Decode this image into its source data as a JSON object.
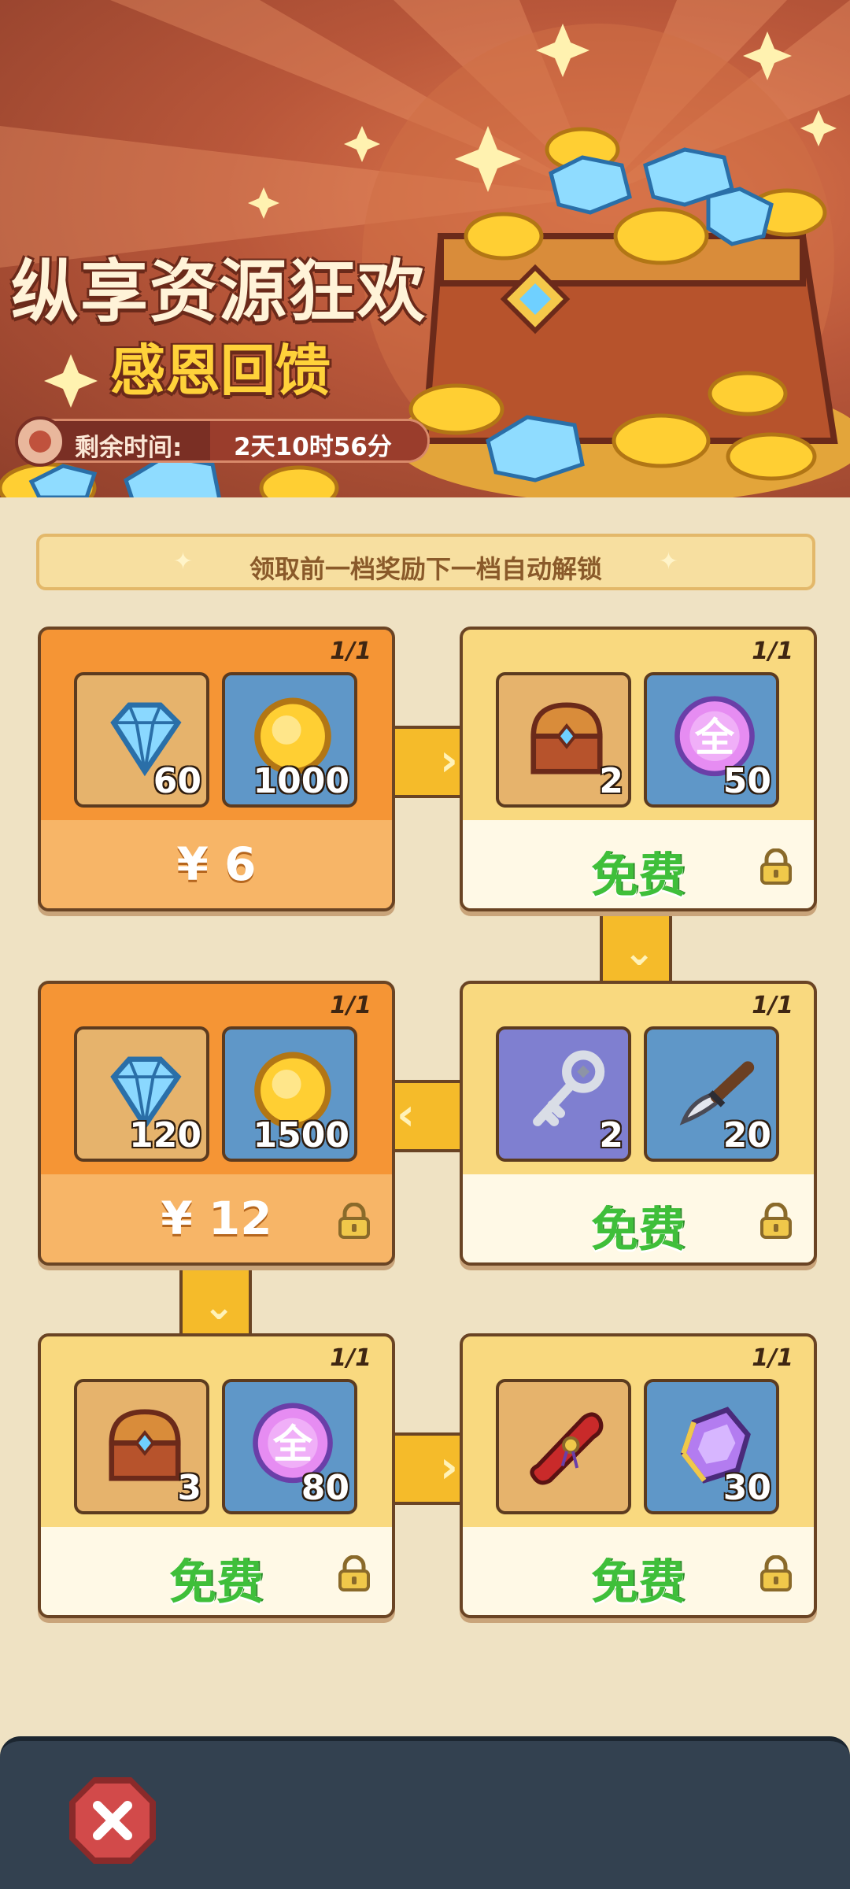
{
  "banner": {
    "title": "纵享资源狂欢",
    "subtitle": "感恩回馈",
    "timer_label": "剩余时间:",
    "timer_value": "2天10时56分"
  },
  "hint": {
    "text": "领取前一档奖励下一档自动解锁"
  },
  "colors": {
    "paid": "#f59535",
    "free": "#f9d97f",
    "free_text": "#3fbf3a",
    "connector": "#f5bb2a"
  },
  "tiers": [
    {
      "count": "1/1",
      "price": "¥ 6",
      "locked": false,
      "items": [
        {
          "icon": "diamond-icon",
          "qty": "60"
        },
        {
          "icon": "gold-coin-icon",
          "qty": "1000"
        }
      ]
    },
    {
      "count": "1/1",
      "price": "免费",
      "locked": true,
      "items": [
        {
          "icon": "treasure-chest-icon",
          "qty": "2"
        },
        {
          "icon": "all-orb-icon",
          "orb_text": "全",
          "qty": "50"
        }
      ]
    },
    {
      "count": "1/1",
      "price": "免费",
      "locked": true,
      "items": [
        {
          "icon": "key-icon",
          "qty": "2"
        },
        {
          "icon": "dagger-icon",
          "qty": "20"
        }
      ]
    },
    {
      "count": "1/1",
      "price": "¥ 12",
      "locked": true,
      "items": [
        {
          "icon": "diamond-icon",
          "qty": "120"
        },
        {
          "icon": "gold-coin-icon",
          "qty": "1500"
        }
      ]
    },
    {
      "count": "1/1",
      "price": "免费",
      "locked": true,
      "items": [
        {
          "icon": "treasure-chest-icon",
          "qty": "3"
        },
        {
          "icon": "all-orb-icon",
          "orb_text": "全",
          "qty": "80"
        }
      ]
    },
    {
      "count": "1/1",
      "price": "免费",
      "locked": true,
      "items": [
        {
          "icon": "scroll-icon",
          "qty": ""
        },
        {
          "icon": "purple-crystal-icon",
          "qty": "30"
        }
      ]
    }
  ],
  "bottom_bar": {
    "close_icon": "close-icon"
  }
}
